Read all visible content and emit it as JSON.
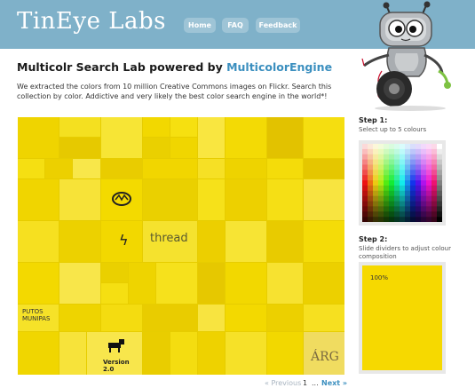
{
  "header": {
    "logo": "TinEye Labs",
    "nav": [
      {
        "label": "Home"
      },
      {
        "label": "FAQ"
      },
      {
        "label": "Feedback"
      }
    ]
  },
  "main": {
    "title_prefix": "Multicolr Search Lab powered by ",
    "title_link": "MulticolorEngine",
    "intro": "We extracted the colors from 10 million Creative Commons images on Flickr. Search this collection by color. Addictive and very likely the best color search engine in the world*!"
  },
  "mosaic": {
    "text_tiles": [
      "thread",
      "PUTOS MUNIPAS",
      "Version 2.0",
      "ÁRG"
    ]
  },
  "sidebar": {
    "step1_title": "Step 1:",
    "step1_desc": "Select up to 5 colours",
    "step2_title": "Step 2:",
    "step2_desc": "Slide dividers to adjust colour composition",
    "composition": [
      {
        "color": "#f6d900",
        "percent": "100%"
      }
    ]
  },
  "pagination": {
    "prev": "« Previous",
    "current": "1",
    "ellipsis": "...",
    "next": "Next »"
  },
  "colors": {
    "header_bg": "#7fb1c9",
    "accent": "#3b8fbf",
    "selected_color": "#f6d900"
  }
}
